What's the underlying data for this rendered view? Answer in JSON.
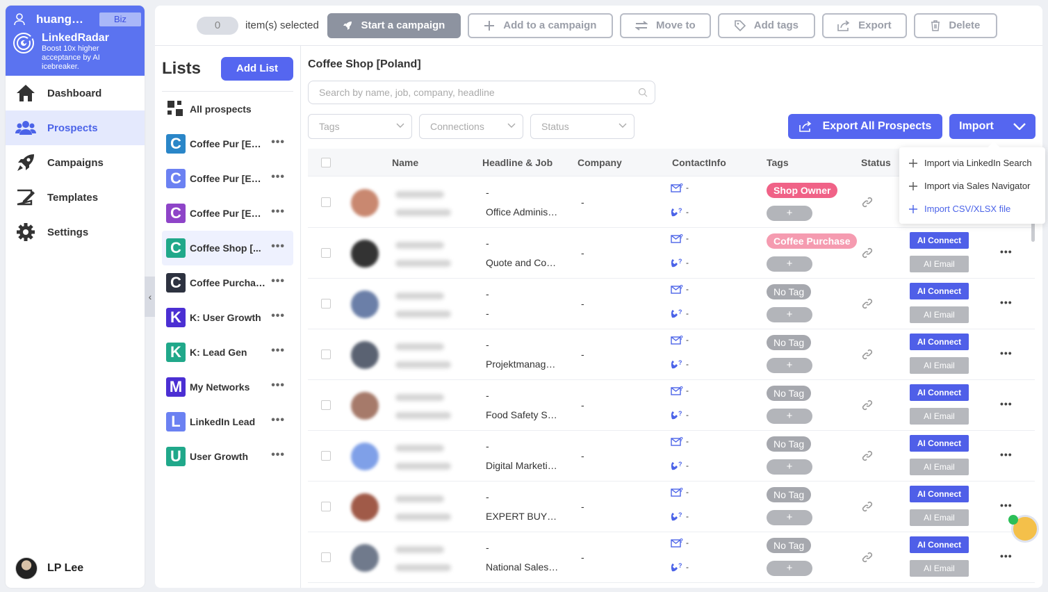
{
  "sidebar": {
    "username": "huangr…",
    "plan_badge": "Biz",
    "brand_name": "LinkedRadar",
    "brand_tagline": "Boost 10x higher acceptance by AI icebreaker.",
    "nav": [
      {
        "label": "Dashboard",
        "icon": "home-icon"
      },
      {
        "label": "Prospects",
        "icon": "users-icon"
      },
      {
        "label": "Campaigns",
        "icon": "rocket-icon"
      },
      {
        "label": "Templates",
        "icon": "template-icon"
      },
      {
        "label": "Settings",
        "icon": "gear-icon"
      }
    ],
    "profile_name": "LP Lee"
  },
  "toolbar": {
    "selected_count": "0",
    "selected_text": "item(s) selected",
    "start_campaign": "Start a campaign",
    "add_to_campaign": "Add to a campaign",
    "move_to": "Move to",
    "add_tags": "Add tags",
    "export": "Export",
    "delete": "Delete"
  },
  "lists": {
    "title": "Lists",
    "add_button": "Add List",
    "all_prospects": "All prospects",
    "items": [
      {
        "letter": "C",
        "name": "Coffee Pur [E…",
        "color": "#2a86c8"
      },
      {
        "letter": "C",
        "name": "Coffee Pur [E…",
        "color": "#6b81f2"
      },
      {
        "letter": "C",
        "name": "Coffee Pur [E…",
        "color": "#8e44c8"
      },
      {
        "letter": "C",
        "name": "Coffee Shop [...",
        "color": "#20a88a"
      },
      {
        "letter": "C",
        "name": "Coffee Purcha…",
        "color": "#2d3240"
      },
      {
        "letter": "K",
        "name": "K: User Growth",
        "color": "#4b2fd3"
      },
      {
        "letter": "K",
        "name": "K: Lead Gen",
        "color": "#20a88a"
      },
      {
        "letter": "M",
        "name": "My Networks",
        "color": "#4b2fd3"
      },
      {
        "letter": "L",
        "name": "LinkedIn Lead",
        "color": "#6b81f2"
      },
      {
        "letter": "U",
        "name": "User Growth",
        "color": "#20a88a"
      }
    ]
  },
  "content": {
    "title": "Coffee Shop [Poland]",
    "search_placeholder": "Search by name, job, company, headline",
    "filters": {
      "tags": "Tags",
      "connections": "Connections",
      "status": "Status"
    },
    "export_all": "Export All Prospects",
    "import": "Import"
  },
  "table": {
    "columns": [
      "Name",
      "Headline & Job",
      "Company",
      "ContactInfo",
      "Tags",
      "Status"
    ],
    "rows": [
      {
        "headline": "-",
        "job": "Office Adminis…",
        "company": "-",
        "tag": "Shop Owner",
        "tag_kind": "shop",
        "avatar_color": "#c98870"
      },
      {
        "headline": "-",
        "job": "Quote and Co…",
        "company": "-",
        "tag": "Coffee Purchase",
        "tag_kind": "coffee",
        "avatar_color": "#333333"
      },
      {
        "headline": "-",
        "job": "-",
        "company": "-",
        "tag": "No Tag",
        "tag_kind": "none",
        "avatar_color": "#6b7fa8"
      },
      {
        "headline": "-",
        "job": "Projektmanag…",
        "company": "-",
        "tag": "No Tag",
        "tag_kind": "none",
        "avatar_color": "#5a6272"
      },
      {
        "headline": "-",
        "job": "Food Safety S…",
        "company": "-",
        "tag": "No Tag",
        "tag_kind": "none",
        "avatar_color": "#a67a6a"
      },
      {
        "headline": "-",
        "job": "Digital Marketi…",
        "company": "-",
        "tag": "No Tag",
        "tag_kind": "none",
        "avatar_color": "#7fa0e8"
      },
      {
        "headline": "-",
        "job": "EXPERT BUY…",
        "company": "-",
        "tag": "No Tag",
        "tag_kind": "none",
        "avatar_color": "#a05a48"
      },
      {
        "headline": "-",
        "job": "National Sales…",
        "company": "-",
        "tag": "No Tag",
        "tag_kind": "none",
        "avatar_color": "#707a8c"
      }
    ],
    "tag_add": "+",
    "ai_connect": "AI Connect",
    "ai_email": "AI Email",
    "contact_dash": "-"
  },
  "dropdown": {
    "items": [
      "Import via LinkedIn Search",
      "Import via Sales Navigator",
      "Import CSV/XLSX file"
    ]
  }
}
